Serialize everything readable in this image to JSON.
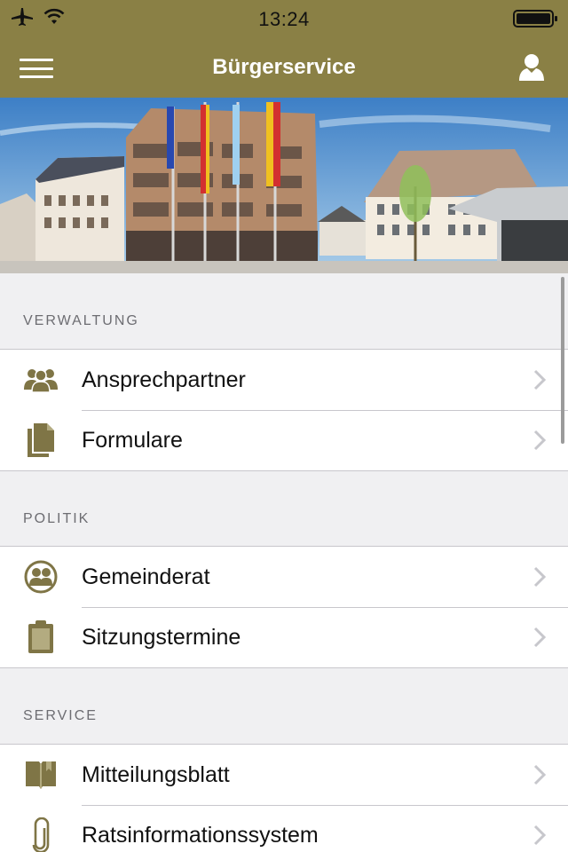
{
  "status_bar": {
    "time": "13:24"
  },
  "nav": {
    "title": "Bürgerservice"
  },
  "colors": {
    "accent": "#8a8045",
    "icon": "#7f7546",
    "chevron": "#c7c7cc"
  },
  "sections": [
    {
      "header": "VERWALTUNG",
      "items": [
        {
          "label": "Ansprechpartner",
          "icon": "people-group-icon"
        },
        {
          "label": "Formulare",
          "icon": "documents-icon"
        }
      ]
    },
    {
      "header": "POLITIK",
      "items": [
        {
          "label": "Gemeinderat",
          "icon": "council-icon"
        },
        {
          "label": "Sitzungstermine",
          "icon": "clipboard-icon"
        }
      ]
    },
    {
      "header": "SERVICE",
      "items": [
        {
          "label": "Mitteilungsblatt",
          "icon": "book-icon"
        },
        {
          "label": "Ratsinformationssystem",
          "icon": "paperclip-icon"
        }
      ]
    }
  ]
}
